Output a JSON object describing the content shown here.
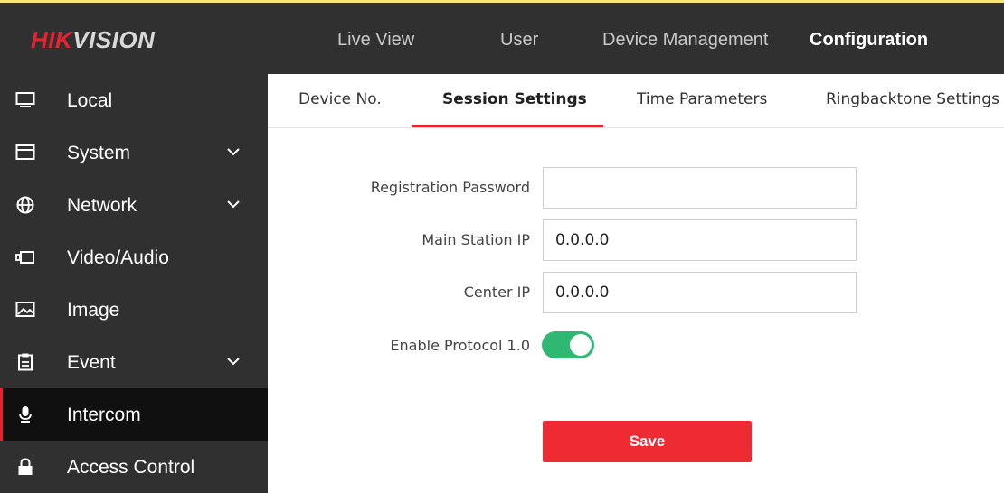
{
  "header": {
    "logo_part1": "HIK",
    "logo_part2": "VISION",
    "nav": [
      "Live View",
      "User",
      "Device Management",
      "Configuration"
    ],
    "active_nav": "Configuration"
  },
  "sidebar": {
    "items": [
      {
        "label": "Local",
        "icon": "monitor-icon",
        "expandable": false
      },
      {
        "label": "System",
        "icon": "system-window-icon",
        "expandable": true
      },
      {
        "label": "Network",
        "icon": "globe-icon",
        "expandable": true
      },
      {
        "label": "Video/Audio",
        "icon": "video-audio-icon",
        "expandable": false
      },
      {
        "label": "Image",
        "icon": "image-icon",
        "expandable": false
      },
      {
        "label": "Event",
        "icon": "clipboard-icon",
        "expandable": true
      },
      {
        "label": "Intercom",
        "icon": "microphone-icon",
        "expandable": false
      },
      {
        "label": "Access Control",
        "icon": "lock-icon",
        "expandable": false
      }
    ],
    "active_item": "Intercom"
  },
  "tabs": [
    "Device No.",
    "Session Settings",
    "Time Parameters",
    "Ringbacktone Settings"
  ],
  "active_tab": "Session Settings",
  "form": {
    "registration_password_label": "Registration Password",
    "registration_password_value": "",
    "main_station_ip_label": "Main Station IP",
    "main_station_ip_value": "0.0.0.0",
    "center_ip_label": "Center IP",
    "center_ip_value": "0.0.0.0",
    "enable_protocol_label": "Enable Protocol 1.0",
    "enable_protocol_on": true,
    "save_label": "Save"
  },
  "colors": {
    "accent_red": "#e8212f",
    "toggle_green": "#2eb872",
    "dark_bg": "#303030"
  }
}
